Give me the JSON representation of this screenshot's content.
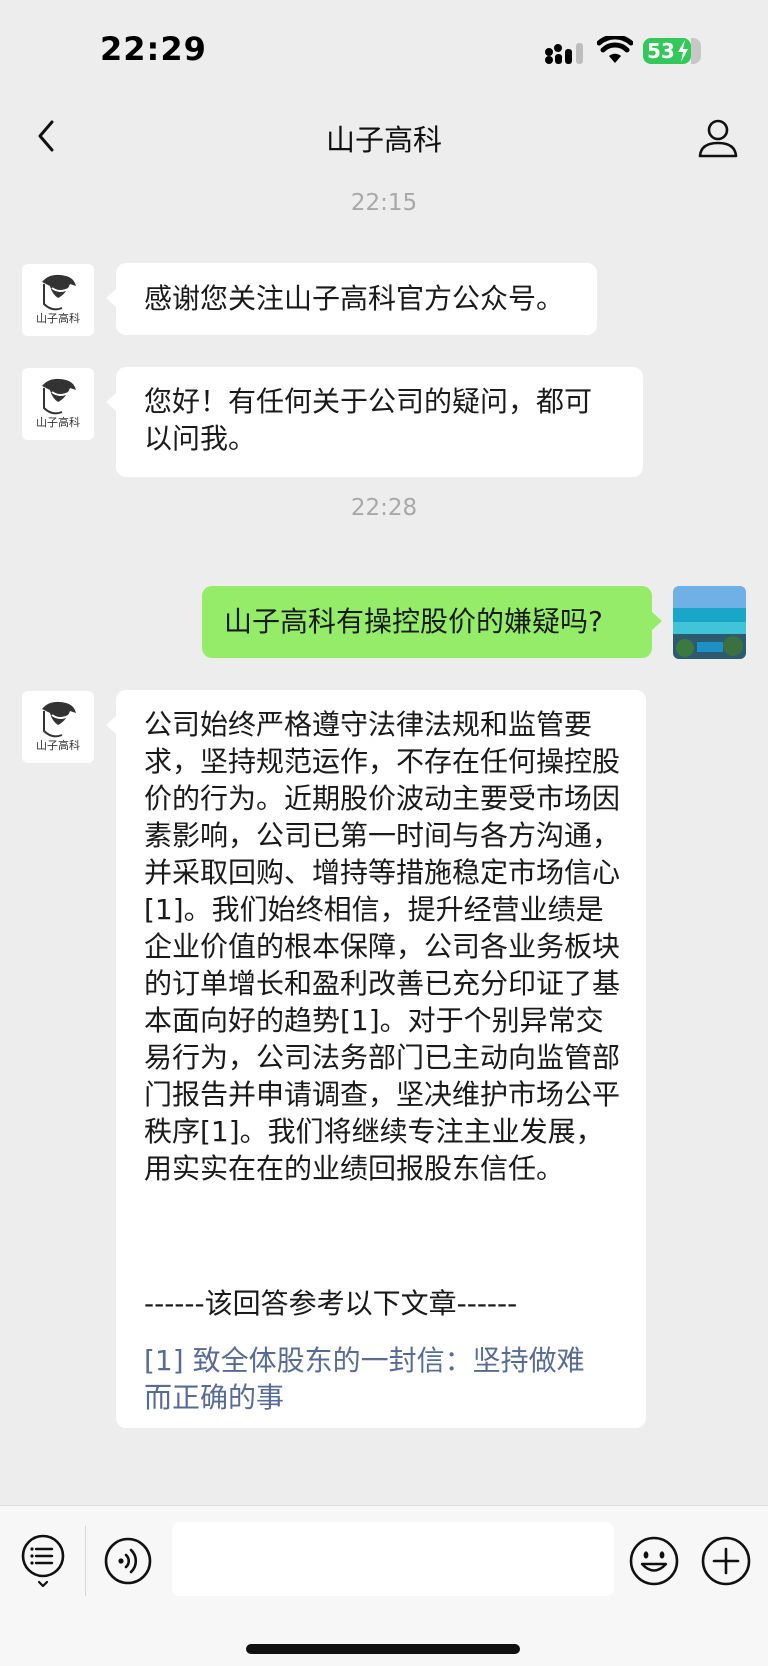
{
  "status_bar": {
    "time": "22:29",
    "battery": "53"
  },
  "nav": {
    "title": "山子高科"
  },
  "bot_avatar_text": "山子高科",
  "messages": [
    {
      "type": "timestamp",
      "text": "22:15"
    },
    {
      "type": "bot",
      "text": "感谢您关注山子高科官方公众号。"
    },
    {
      "type": "bot",
      "text": "您好！有任何关于公司的疑问，都可以问我。"
    },
    {
      "type": "timestamp",
      "text": "22:28"
    },
    {
      "type": "user",
      "text": "山子高科有操控股价的嫌疑吗?"
    },
    {
      "type": "bot",
      "text": "公司始终严格遵守法律法规和监管要求，坚持规范运作，不存在任何操控股价的行为。近期股价波动主要受市场因素影响，公司已第一时间与各方沟通，并采取回购、增持等措施稳定市场信心[1]。我们始终相信，提升经营业绩是企业价值的根本保障，公司各业务板块的订单增长和盈利改善已充分印证了基本面向好的趋势[1]。对于个别异常交易行为，公司法务部门已主动向监管部门报告并申请调查，坚决维护市场公平秩序[1]。我们将继续专注主业发展，用实实在在的业绩回报股东信任。",
      "ref_header": "------该回答参考以下文章------",
      "ref_link": "[1] 致全体股东的一封信：坚持做难而正确的事"
    }
  ],
  "colors": {
    "background": "#ededed",
    "user_bubble": "#95ec69",
    "bot_bubble": "#ffffff",
    "link": "#576b95",
    "battery": "#34c759"
  },
  "icons": [
    "back-chevron-icon",
    "person-icon",
    "menu-list-icon",
    "voice-icon",
    "emoji-icon",
    "plus-icon",
    "signal-icon",
    "wifi-icon",
    "battery-icon"
  ]
}
